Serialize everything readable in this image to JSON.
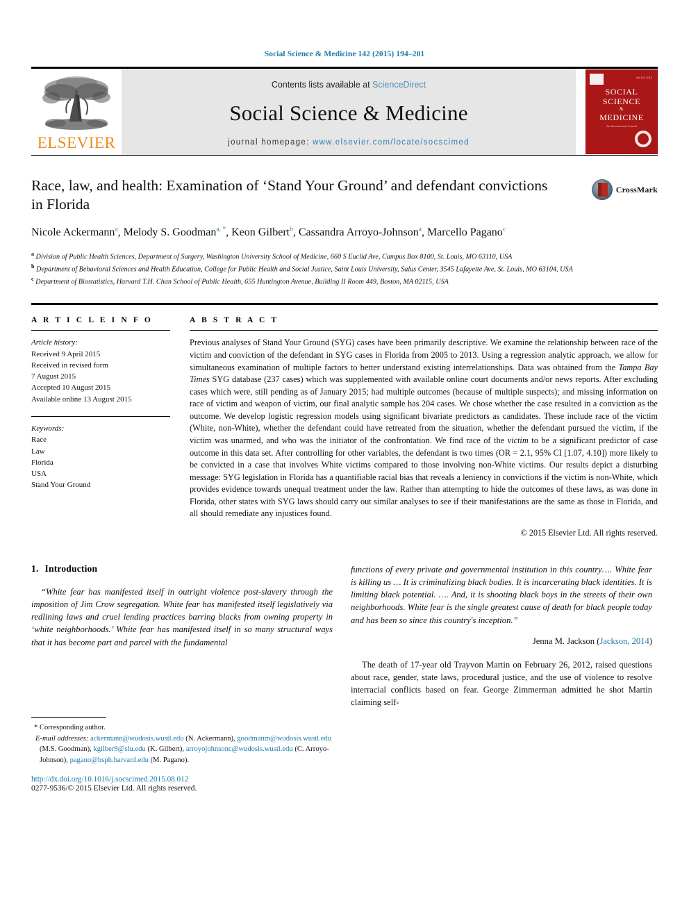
{
  "running_head": "Social Science & Medicine 142 (2015) 194–201",
  "masthead": {
    "publisher_wordmark": "ELSEVIER",
    "contents_prefix": "Contents lists available at ",
    "contents_link": "ScienceDirect",
    "journal_title": "Social Science & Medicine",
    "homepage_prefix": "journal homepage: ",
    "homepage_url": "www.elsevier.com/locate/socscimed",
    "cover": {
      "line1": "SOCIAL",
      "line2": "SCIENCE",
      "amp": "&",
      "line3": "MEDICINE",
      "tagline": "An International Journal",
      "issue_note": "Vol 142 2015"
    }
  },
  "crossmark": {
    "label": "CrossMark"
  },
  "article": {
    "title": "Race, law, and health: Examination of ‘Stand Your Ground’ and defendant convictions in Florida",
    "authors": [
      {
        "name": "Nicole Ackermann",
        "marks": "a",
        "sep": ", "
      },
      {
        "name": "Melody S. Goodman",
        "marks": "a, *",
        "sep": ", "
      },
      {
        "name": "Keon Gilbert",
        "marks": "b",
        "sep": ", "
      },
      {
        "name": "Cassandra Arroyo-Johnson",
        "marks": "a",
        "sep": ", "
      },
      {
        "name": "Marcello Pagano",
        "marks": "c",
        "sep": ""
      }
    ],
    "affiliations": [
      {
        "mark": "a",
        "text": "Division of Public Health Sciences, Department of Surgery, Washington University School of Medicine, 660 S Euclid Ave, Campus Box 8100, St. Louis, MO 63110, USA"
      },
      {
        "mark": "b",
        "text": "Department of Behavioral Sciences and Health Education, College for Public Health and Social Justice, Saint Louis University, Salus Center, 3545 Lafayette Ave, St. Louis, MO 63104, USA"
      },
      {
        "mark": "c",
        "text": "Department of Biostatistics, Harvard T.H. Chan School of Public Health, 655 Huntington Avenue, Building II Room 449, Boston, MA 02115, USA"
      }
    ]
  },
  "article_info": {
    "heading": "A R T I C L E  I N F O",
    "history_label": "Article history:",
    "history": [
      "Received 9 April 2015",
      "Received in revised form",
      "7 August 2015",
      "Accepted 10 August 2015",
      "Available online 13 August 2015"
    ],
    "keywords_label": "Keywords:",
    "keywords": [
      "Race",
      "Law",
      "Florida",
      "USA",
      "Stand Your Ground"
    ]
  },
  "abstract": {
    "heading": "A B S T R A C T",
    "part1": "Previous analyses of Stand Your Ground (SYG) cases have been primarily descriptive. We examine the relationship between race of the victim and conviction of the defendant in SYG cases in Florida from 2005 to 2013. Using a regression analytic approach, we allow for simultaneous examination of multiple factors to better understand existing interrelationships. Data was obtained from the ",
    "italic1": "Tampa Bay Times",
    "part2": " SYG database (237 cases) which was supplemented with available online court documents and/or news reports. After excluding cases which were, still pending as of January 2015; had multiple outcomes (because of multiple suspects); and missing information on race of victim and weapon of victim, our final analytic sample has 204 cases. We chose whether the case resulted in a conviction as the outcome. We develop logistic regression models using significant bivariate predictors as candidates. These include race of the victim (White, non-White), whether the defendant could have retreated from the situation, whether the defendant pursued the victim, if the victim was unarmed, and who was the initiator of the confrontation. We find race of the ",
    "italic2": "victim",
    "part3": " to be a significant predictor of case outcome in this data set. After controlling for other variables, the defendant is two times (OR = 2.1, 95% CI [1.07, 4.10]) more likely to be convicted in a case that involves White victims compared to those involving non-White victims. Our results depict a disturbing message: SYG legislation in Florida has a quantifiable racial bias that reveals a leniency in convictions if the victim is non-White, which provides evidence towards unequal treatment under the law. Rather than attempting to hide the outcomes of these laws, as was done in Florida, other states with SYG laws should carry out similar analyses to see if their manifestations are the same as those in Florida, and all should remediate any injustices found.",
    "copyright": "© 2015 Elsevier Ltd. All rights reserved."
  },
  "introduction": {
    "number": "1.",
    "heading": "Introduction",
    "quote_left": "“White fear has manifested itself in outright violence post-slavery through the imposition of Jim Crow segregation. White fear has manifested itself legislatively via redlining laws and cruel lending practices barring blacks from owning property in ‘white neighborhoods.’ White fear has manifested itself in so many structural ways that it has become part and parcel with the fundamental",
    "quote_right": "functions of every private and governmental institution in this country…. White fear is killing us … It is criminalizing black bodies. It is incarcerating black identities. It is limiting black potential. …. And, it is shooting black boys in the streets of their own neighborhoods. White fear is the single greatest cause of death for black people today and has been so since this country's inception.”",
    "attribution_name": "Jenna M. Jackson (",
    "attribution_link": "Jackson, 2014",
    "attribution_close": ")",
    "para1": "The death of 17-year old Trayvon Martin on February 26, 2012, raised questions about race, gender, state laws, procedural justice, and the use of violence to resolve interracial conflicts based on fear. George Zimmerman admitted he shot Martin claiming self-"
  },
  "footnote": {
    "corresponding": "* Corresponding author.",
    "email_label": "E-mail addresses:",
    "emails": [
      {
        "address": "ackermann@wudosis.wustl.edu",
        "owner": " (N. Ackermann), "
      },
      {
        "address": "goodmanm@wudosis.wustl.edu",
        "owner": " (M.S. Goodman), "
      },
      {
        "address": "kgilber9@slu.edu",
        "owner": " (K. Gilbert), "
      },
      {
        "address": "arroyojohnsonc@wudosis.wustl.edu",
        "owner": " (C. Arroyo-Johnson), "
      },
      {
        "address": "pagano@hsph.harvard.edu",
        "owner": " (M. Pagano)."
      }
    ],
    "doi": "http://dx.doi.org/10.1016/j.socscimed.2015.08.012",
    "issn": "0277-9536/© 2015 Elsevier Ltd. All rights reserved."
  },
  "colors": {
    "link_blue": "#1b78a8",
    "sciencedirect_blue": "#4e90b5",
    "elsevier_orange": "#ec8b22",
    "cover_red": "#ab1717",
    "band_grey": "#e6e6e6"
  }
}
